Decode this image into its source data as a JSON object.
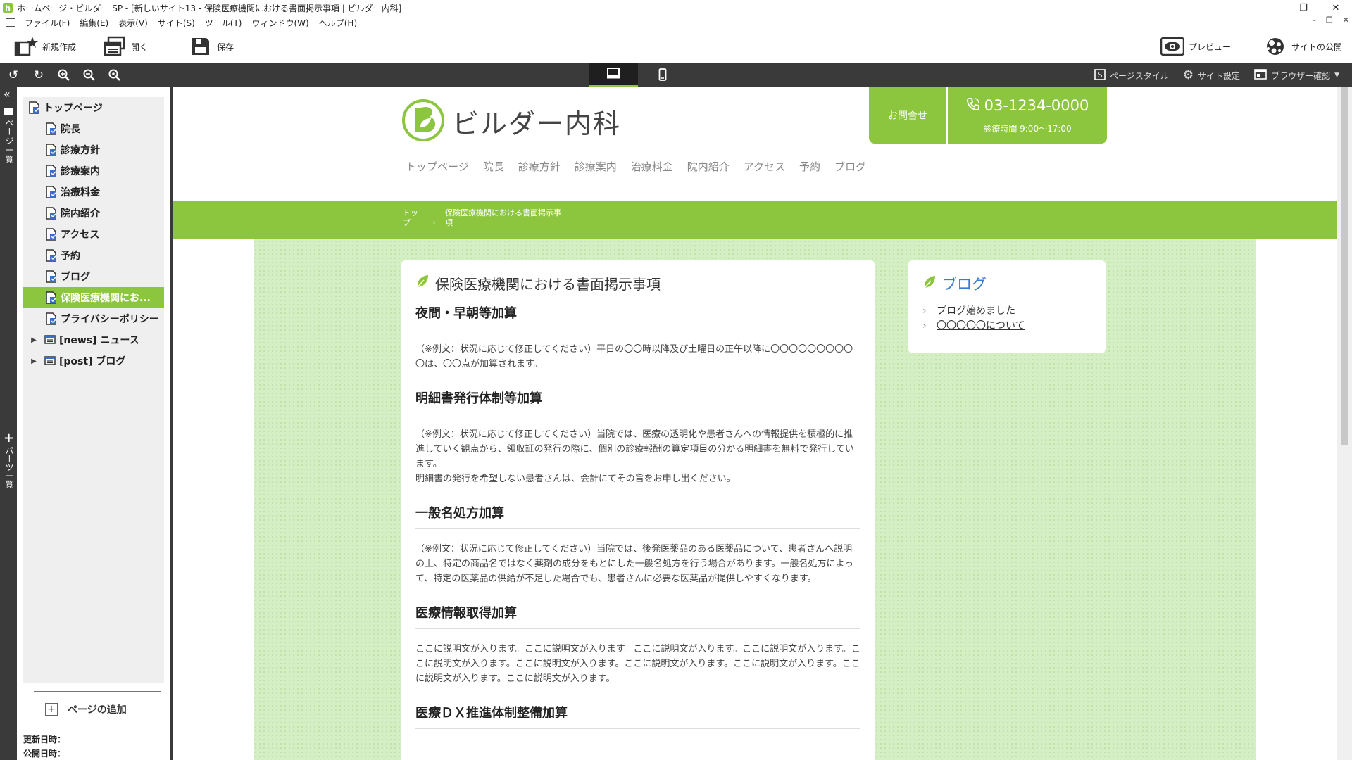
{
  "window": {
    "title": "ホームページ・ビルダー SP - [新しいサイト13 - 保険医療機関における書面掲示事項 | ビルダー内科]",
    "minimize": "—",
    "maximize": "❐",
    "close": "✕"
  },
  "menu": [
    "ファイル(F)",
    "編集(E)",
    "表示(V)",
    "サイト(S)",
    "ツール(T)",
    "ウィンドウ(W)",
    "ヘルプ(H)"
  ],
  "mdi": {
    "min": "–",
    "restore": "❐",
    "close": "✕"
  },
  "toolbar": {
    "new_label": "新規作成",
    "open_label": "開く",
    "save_label": "保存",
    "preview_label": "プレビュー",
    "publish_label": "サイトの公開"
  },
  "subtoolbar": {
    "page_style": "ページスタイル",
    "site_settings": "サイト設定",
    "browser_check": "ブラウザー確認"
  },
  "left_strip": {
    "collapse": "«",
    "page_list_tab": "ページ一覧",
    "parts_tab": "パーツ一覧",
    "parts_plus": "+"
  },
  "tree": {
    "root": "トップページ",
    "pages": [
      "院長",
      "診療方針",
      "診療案内",
      "治療料金",
      "院内紹介",
      "アクセス",
      "予約",
      "ブログ",
      "保険医療機関にお...",
      "プライバシーポリシー"
    ],
    "selected_index": 8,
    "news": "[news] ニュース",
    "post": "[post] ブログ",
    "add_page": "ページの追加",
    "updated": "更新日時：",
    "published": "公開日時："
  },
  "site": {
    "name": "ビルダー内科",
    "contact_label": "お問合せ",
    "phone": "03-1234-0000",
    "hours": "診療時間 9:00〜17:00",
    "nav": [
      "トップページ",
      "院長",
      "診療方針",
      "診療案内",
      "治療料金",
      "院内紹介",
      "アクセス",
      "予約",
      "ブログ"
    ],
    "breadcrumb_top": "トップ",
    "breadcrumb_sep": "›",
    "breadcrumb_current": "保険医療機関における書面掲示事項",
    "article_title": "保険医療機関における書面掲示事項",
    "sections": [
      {
        "heading": "夜間・早朝等加算",
        "body": "（※例文：状況に応じて修正してください）平日の〇〇時以降及び土曜日の正午以降に〇〇〇〇〇〇〇〇〇〇は、〇〇点が加算されます。"
      },
      {
        "heading": "明細書発行体制等加算",
        "body": "（※例文：状況に応じて修正してください）当院では、医療の透明化や患者さんへの情報提供を積極的に推進していく観点から、領収証の発行の際に、個別の診療報酬の算定項目の分かる明細書を無料で発行しています。\n明細書の発行を希望しない患者さんは、会計にてその旨をお申し出ください。"
      },
      {
        "heading": "一般名処方加算",
        "body": "（※例文：状況に応じて修正してください）当院では、後発医薬品のある医薬品について、患者さんへ説明の上、特定の商品名ではなく薬剤の成分をもとにした一般名処方を行う場合があります。一般名処方によって、特定の医薬品の供給が不足した場合でも、患者さんに必要な医薬品が提供しやすくなります。"
      },
      {
        "heading": "医療情報取得加算",
        "body": "ここに説明文が入ります。ここに説明文が入ります。ここに説明文が入ります。ここに説明文が入ります。ここに説明文が入ります。ここに説明文が入ります。ここに説明文が入ります。ここに説明文が入ります。ここに説明文が入ります。ここに説明文が入ります。"
      },
      {
        "heading": "医療ＤＸ推進体制整備加算",
        "body": ""
      }
    ],
    "blog_title": "ブログ",
    "blog_items": [
      "ブログ始めました",
      "〇〇〇〇〇について"
    ]
  },
  "colors": {
    "accent": "#8cc63f",
    "dark": "#3a3a3a",
    "background_tint": "#d5efc4",
    "blog_title": "#3a7bd5"
  }
}
